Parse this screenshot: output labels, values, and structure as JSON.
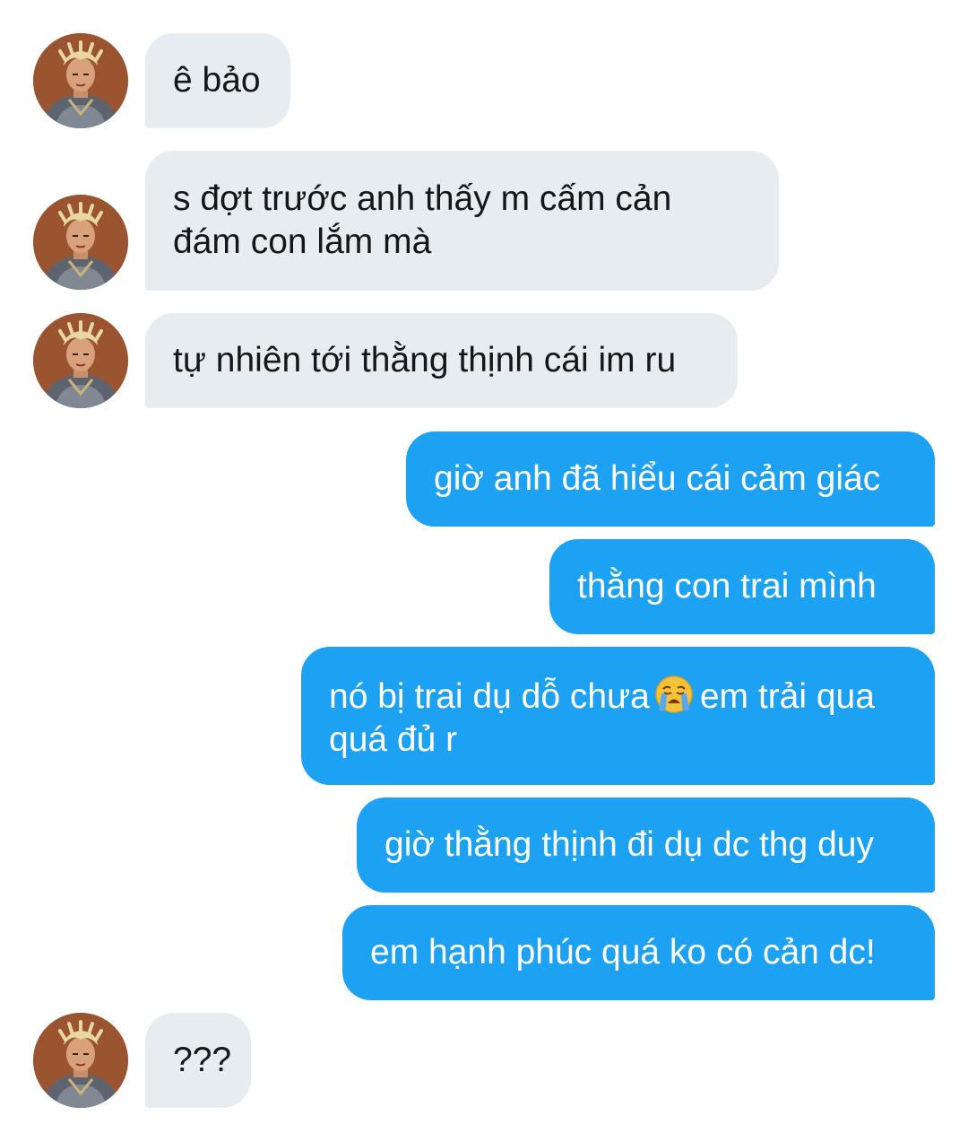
{
  "colors": {
    "incoming_bubble": "#e6ecf0",
    "outgoing_bubble": "#1da1f2",
    "incoming_text": "#14171a",
    "outgoing_text": "#ffffff"
  },
  "messages": [
    {
      "direction": "incoming",
      "text": "ê bảo"
    },
    {
      "direction": "incoming",
      "text": "s đợt trước anh thấy m cấm cản đám con lắm mà"
    },
    {
      "direction": "incoming",
      "text": "tự nhiên tới thằng thịnh cái im ru"
    },
    {
      "direction": "outgoing",
      "text": "giờ anh đã hiểu cái cảm giác"
    },
    {
      "direction": "outgoing",
      "text": "thằng con trai mình"
    },
    {
      "direction": "outgoing",
      "text_before_emoji": "nó bị trai dụ dỗ chưa",
      "emoji": "loudly-crying-face-icon",
      "text_after_emoji": "em trải qua quá đủ r"
    },
    {
      "direction": "outgoing",
      "text": "giờ thằng thịnh đi dụ dc thg duy"
    },
    {
      "direction": "outgoing",
      "text": "em hạnh phúc quá ko có cản dc!"
    },
    {
      "direction": "incoming",
      "text": "???"
    }
  ]
}
